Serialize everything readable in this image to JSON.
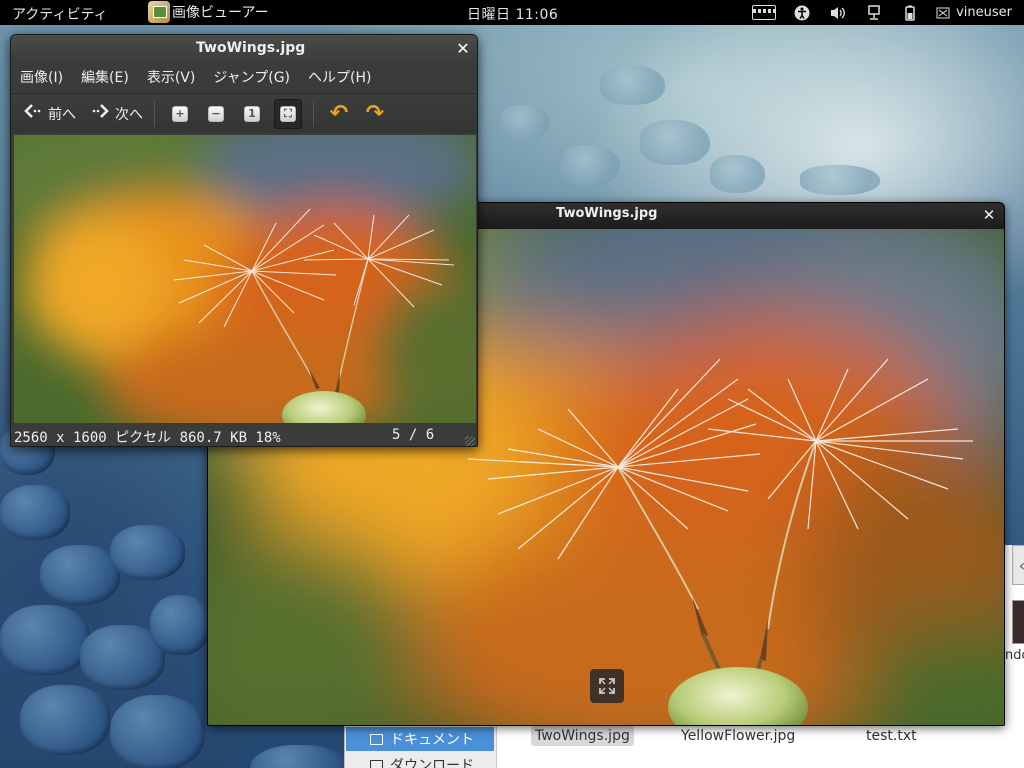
{
  "topbar": {
    "activities": "アクティビティ",
    "app_name": "画像ビューアー",
    "clock": "日曜日 11:06",
    "user": "vineuser",
    "icons": [
      "keyboard-icon",
      "accessibility-icon",
      "volume-icon",
      "network-icon",
      "battery-icon",
      "user-icon"
    ]
  },
  "viewer": {
    "title": "TwoWings.jpg",
    "close": "✕",
    "menu": [
      "画像(I)",
      "編集(E)",
      "表示(V)",
      "ジャンプ(G)",
      "ヘルプ(H)"
    ],
    "toolbar": {
      "prev": "前へ",
      "next": "次へ",
      "icons": [
        "zoom-in-icon",
        "zoom-out-icon",
        "zoom-normal-icon",
        "zoom-fit-icon",
        "rotate-left-icon",
        "rotate-right-icon"
      ]
    },
    "status": {
      "info": "2560 x 1600 ピクセル 860.7 KB  18%",
      "position": "5 / 6"
    }
  },
  "big_window": {
    "title": "TwoWings.jpg",
    "close": "✕"
  },
  "file_manager": {
    "sidebar": [
      "ドキュメント",
      "ダウンロード"
    ],
    "files": [
      "TwoWings.jpg",
      "YellowFlower.jpg",
      "test.txt"
    ],
    "partial_label": "ndo"
  },
  "colors": {
    "accent": "#4a90d9",
    "rotate_arrow": "#f0a020",
    "topbar_bg": "#000000"
  }
}
